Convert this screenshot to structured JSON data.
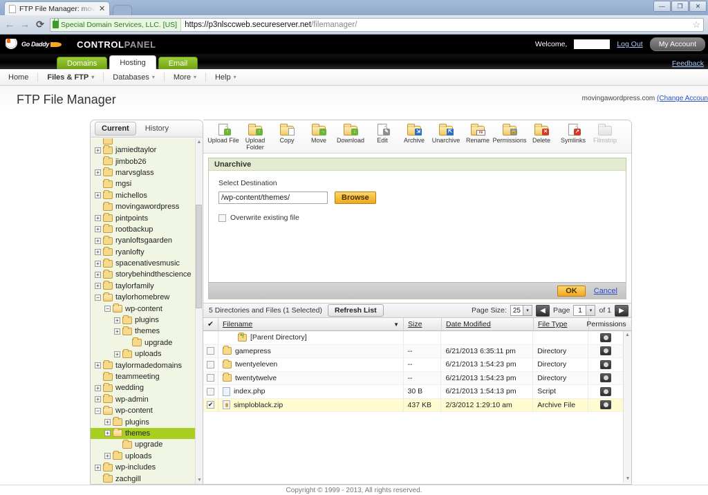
{
  "browser": {
    "tab_title": "FTP File Manager: moving",
    "tab_close": "✕",
    "back_icon": "←",
    "forward_icon": "→",
    "reload_icon": "⟳",
    "ev_badge": "Special Domain Services, LLC. [US]",
    "url_secure": "https://p3nlsccweb.secureserver.net",
    "url_path": "/filemanager/",
    "star_icon": "☆",
    "win_minimize": "—",
    "win_maximize": "❐",
    "win_close": "✕"
  },
  "header": {
    "logo_text": "Go Daddy",
    "title_bold": "CONTROL",
    "title_light": "PANEL",
    "welcome_label": "Welcome,",
    "welcome_value": "",
    "logout_label": "Log Out",
    "my_account_label": "My Account",
    "feedback_label": "Feedback"
  },
  "tabnav": {
    "tabs": [
      {
        "label": "Domains",
        "active": false
      },
      {
        "label": "Hosting",
        "active": true
      },
      {
        "label": "Email",
        "active": false
      }
    ]
  },
  "subnav": {
    "items": [
      {
        "label": "Home",
        "caret": ""
      },
      {
        "label": "Files & FTP",
        "caret": "▾"
      },
      {
        "label": "Databases",
        "caret": "▾"
      },
      {
        "label": "More",
        "caret": "▾"
      },
      {
        "label": "Help",
        "caret": "▾"
      }
    ]
  },
  "page": {
    "title": "FTP File Manager",
    "account_domain": "movingawordpress.com",
    "account_change_link": "(Change Accoun"
  },
  "toolbar": {
    "buttons": [
      {
        "label": "Upload File",
        "icon": "upload-file-icon",
        "kind": "doc",
        "badge": "↑",
        "badge_color": "green",
        "disabled": false
      },
      {
        "label": "Upload Folder",
        "icon": "upload-folder-icon",
        "kind": "fold",
        "badge": "↑",
        "badge_color": "green",
        "disabled": false
      },
      {
        "label": "Copy",
        "icon": "copy-icon",
        "kind": "fold",
        "badge": "",
        "badge_color": "copy",
        "disabled": false
      },
      {
        "label": "Move",
        "icon": "move-icon",
        "kind": "fold",
        "badge": "→",
        "badge_color": "green",
        "disabled": false
      },
      {
        "label": "Download",
        "icon": "download-icon",
        "kind": "fold",
        "badge": "↓",
        "badge_color": "green",
        "disabled": false
      },
      {
        "label": "Edit",
        "icon": "edit-icon",
        "kind": "doc",
        "badge": "✎",
        "badge_color": "gray",
        "disabled": false
      },
      {
        "label": "Archive",
        "icon": "archive-icon",
        "kind": "fold",
        "badge": "⇲",
        "badge_color": "blue",
        "disabled": false
      },
      {
        "label": "Unarchive",
        "icon": "unarchive-icon",
        "kind": "fold",
        "badge": "⇱",
        "badge_color": "blue",
        "disabled": false
      },
      {
        "label": "Rename",
        "icon": "rename-icon",
        "kind": "fold",
        "badge": "re",
        "badge_color": "ren",
        "disabled": false
      },
      {
        "label": "Permissions",
        "icon": "permissions-icon",
        "kind": "fold",
        "badge": "🔒",
        "badge_color": "gray",
        "disabled": false
      },
      {
        "label": "Delete",
        "icon": "delete-icon",
        "kind": "fold",
        "badge": "✕",
        "badge_color": "red",
        "disabled": false
      },
      {
        "label": "Symlinks",
        "icon": "symlinks-icon",
        "kind": "doc",
        "badge": "↗",
        "badge_color": "red",
        "disabled": false
      },
      {
        "label": "Filmstrip",
        "icon": "filmstrip-icon",
        "kind": "fold",
        "badge": "",
        "badge_color": "gray",
        "disabled": true
      }
    ]
  },
  "tree": {
    "tabs": [
      {
        "label": "Current",
        "active": true
      },
      {
        "label": "History",
        "active": false
      }
    ],
    "scroll_up": "▲",
    "scroll_down": "▼",
    "nodes": [
      {
        "label": "",
        "indent": 1,
        "twisty": "",
        "open": false,
        "selected": false,
        "clipped": true
      },
      {
        "label": "jamiedtaylor",
        "indent": 1,
        "twisty": "+",
        "open": false,
        "selected": false
      },
      {
        "label": "jimbob26",
        "indent": 1,
        "twisty": "",
        "open": false,
        "selected": false
      },
      {
        "label": "marvsglass",
        "indent": 1,
        "twisty": "+",
        "open": false,
        "selected": false
      },
      {
        "label": "mgsi",
        "indent": 1,
        "twisty": "",
        "open": false,
        "selected": false
      },
      {
        "label": "michellos",
        "indent": 1,
        "twisty": "+",
        "open": false,
        "selected": false
      },
      {
        "label": "movingawordpress",
        "indent": 1,
        "twisty": "",
        "open": false,
        "selected": false
      },
      {
        "label": "pintpoints",
        "indent": 1,
        "twisty": "+",
        "open": false,
        "selected": false
      },
      {
        "label": "rootbackup",
        "indent": 1,
        "twisty": "+",
        "open": false,
        "selected": false
      },
      {
        "label": "ryanloftsgaarden",
        "indent": 1,
        "twisty": "+",
        "open": false,
        "selected": false
      },
      {
        "label": "ryanlofty",
        "indent": 1,
        "twisty": "+",
        "open": false,
        "selected": false
      },
      {
        "label": "spacenativesmusic",
        "indent": 1,
        "twisty": "+",
        "open": false,
        "selected": false
      },
      {
        "label": "storybehindthescience",
        "indent": 1,
        "twisty": "+",
        "open": false,
        "selected": false
      },
      {
        "label": "taylorfamily",
        "indent": 1,
        "twisty": "+",
        "open": false,
        "selected": false
      },
      {
        "label": "taylorhomebrew",
        "indent": 1,
        "twisty": "−",
        "open": true,
        "selected": false
      },
      {
        "label": "wp-content",
        "indent": 2,
        "twisty": "−",
        "open": true,
        "selected": false
      },
      {
        "label": "plugins",
        "indent": 3,
        "twisty": "+",
        "open": false,
        "selected": false
      },
      {
        "label": "themes",
        "indent": 3,
        "twisty": "+",
        "open": false,
        "selected": false
      },
      {
        "label": "upgrade",
        "indent": 4,
        "twisty": "",
        "open": false,
        "selected": false
      },
      {
        "label": "uploads",
        "indent": 3,
        "twisty": "+",
        "open": false,
        "selected": false
      },
      {
        "label": "taylormadedomains",
        "indent": 1,
        "twisty": "+",
        "open": false,
        "selected": false
      },
      {
        "label": "teammeeting",
        "indent": 1,
        "twisty": "",
        "open": false,
        "selected": false
      },
      {
        "label": "wedding",
        "indent": 1,
        "twisty": "+",
        "open": false,
        "selected": false
      },
      {
        "label": "wp-admin",
        "indent": 1,
        "twisty": "+",
        "open": false,
        "selected": false
      },
      {
        "label": "wp-content",
        "indent": 1,
        "twisty": "−",
        "open": true,
        "selected": false
      },
      {
        "label": "plugins",
        "indent": 2,
        "twisty": "+",
        "open": false,
        "selected": false
      },
      {
        "label": "themes",
        "indent": 2,
        "twisty": "+",
        "open": true,
        "selected": true
      },
      {
        "label": "upgrade",
        "indent": 3,
        "twisty": "",
        "open": false,
        "selected": false
      },
      {
        "label": "uploads",
        "indent": 2,
        "twisty": "+",
        "open": false,
        "selected": false
      },
      {
        "label": "wp-includes",
        "indent": 1,
        "twisty": "+",
        "open": false,
        "selected": false
      },
      {
        "label": "zachgill",
        "indent": 1,
        "twisty": "",
        "open": false,
        "selected": false
      }
    ]
  },
  "unarchive_panel": {
    "title": "Unarchive",
    "destination_label": "Select Destination",
    "destination_value": "/wp-content/themes/",
    "destination_placeholder": "",
    "browse_label": "Browse",
    "overwrite_label": "Overwrite existing file",
    "overwrite_checked": false,
    "ok_label": "OK",
    "cancel_label": "Cancel"
  },
  "list_bar": {
    "count_text": "5 Directories and Files (1 Selected)",
    "refresh_label": "Refresh List",
    "page_size_label": "Page Size:",
    "page_size_value": "25",
    "prev_icon": "◀",
    "next_icon": "▶",
    "page_label": "Page",
    "page_value": "1",
    "of_label": "of 1",
    "dropdown_caret": "▾"
  },
  "table": {
    "select_all_icon": "✔",
    "sort_caret": "▼",
    "columns": [
      "Filename",
      "Size",
      "Date Modified",
      "File Type",
      "Permissions"
    ],
    "rows": [
      {
        "checked": null,
        "name": "[Parent Directory]",
        "icon": "parent-folder-icon",
        "size": "",
        "modified": "",
        "type": "",
        "perm": "●"
      },
      {
        "checked": false,
        "name": "gamepress",
        "icon": "folder-icon",
        "size": "--",
        "modified": "6/21/2013 6:35:11 pm",
        "type": "Directory",
        "perm": "●"
      },
      {
        "checked": false,
        "name": "twentyeleven",
        "icon": "folder-icon",
        "size": "--",
        "modified": "6/21/2013 1:54:23 pm",
        "type": "Directory",
        "perm": "●"
      },
      {
        "checked": false,
        "name": "twentytwelve",
        "icon": "folder-icon",
        "size": "--",
        "modified": "6/21/2013 1:54:23 pm",
        "type": "Directory",
        "perm": "●"
      },
      {
        "checked": false,
        "name": "index.php",
        "icon": "php-file-icon",
        "size": "30 B",
        "modified": "6/21/2013 1:54:13 pm",
        "type": "Script",
        "perm": "●"
      },
      {
        "checked": true,
        "name": "simploblack.zip",
        "icon": "zip-file-icon",
        "size": "437 KB",
        "modified": "2/3/2012 1:29:10 am",
        "type": "Archive File",
        "perm": "●"
      }
    ]
  },
  "footer": {
    "copyright": "Copyright © 1999 - 2013, All rights reserved."
  }
}
